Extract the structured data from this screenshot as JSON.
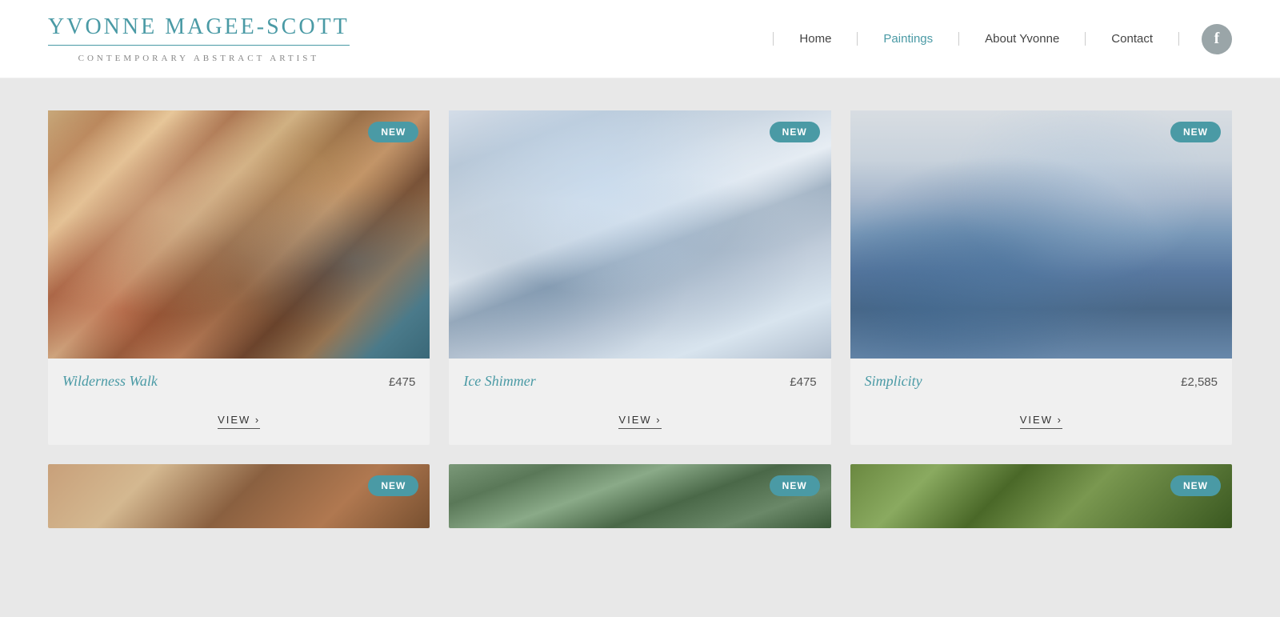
{
  "header": {
    "artist_name": "YVONNE MAGEE-SCOTT",
    "artist_subtitle": "CONTEMPORARY ABSTRACT ARTIST",
    "nav": [
      {
        "label": "Home",
        "active": false
      },
      {
        "label": "Paintings",
        "active": true
      },
      {
        "label": "About Yvonne",
        "active": false
      },
      {
        "label": "Contact",
        "active": false
      }
    ],
    "facebook_label": "f"
  },
  "paintings": [
    {
      "title": "Wilderness Walk",
      "price": "£475",
      "badge": "NEW",
      "view_label": "VIEW ›",
      "canvas_class": "canvas-wilderness"
    },
    {
      "title": "Ice Shimmer",
      "price": "£475",
      "badge": "NEW",
      "view_label": "VIEW ›",
      "canvas_class": "canvas-ice"
    },
    {
      "title": "Simplicity",
      "price": "£2,585",
      "badge": "NEW",
      "view_label": "VIEW ›",
      "canvas_class": "canvas-simplicity"
    }
  ],
  "bottom_row": [
    {
      "badge": "NEW",
      "canvas_class": "canvas-bottom1"
    },
    {
      "badge": "NEW",
      "canvas_class": "canvas-bottom2"
    },
    {
      "badge": "NEW",
      "canvas_class": "canvas-bottom3"
    }
  ],
  "colors": {
    "accent": "#4a9aa5",
    "badge_bg": "#4a9aa5",
    "text_main": "#333"
  }
}
